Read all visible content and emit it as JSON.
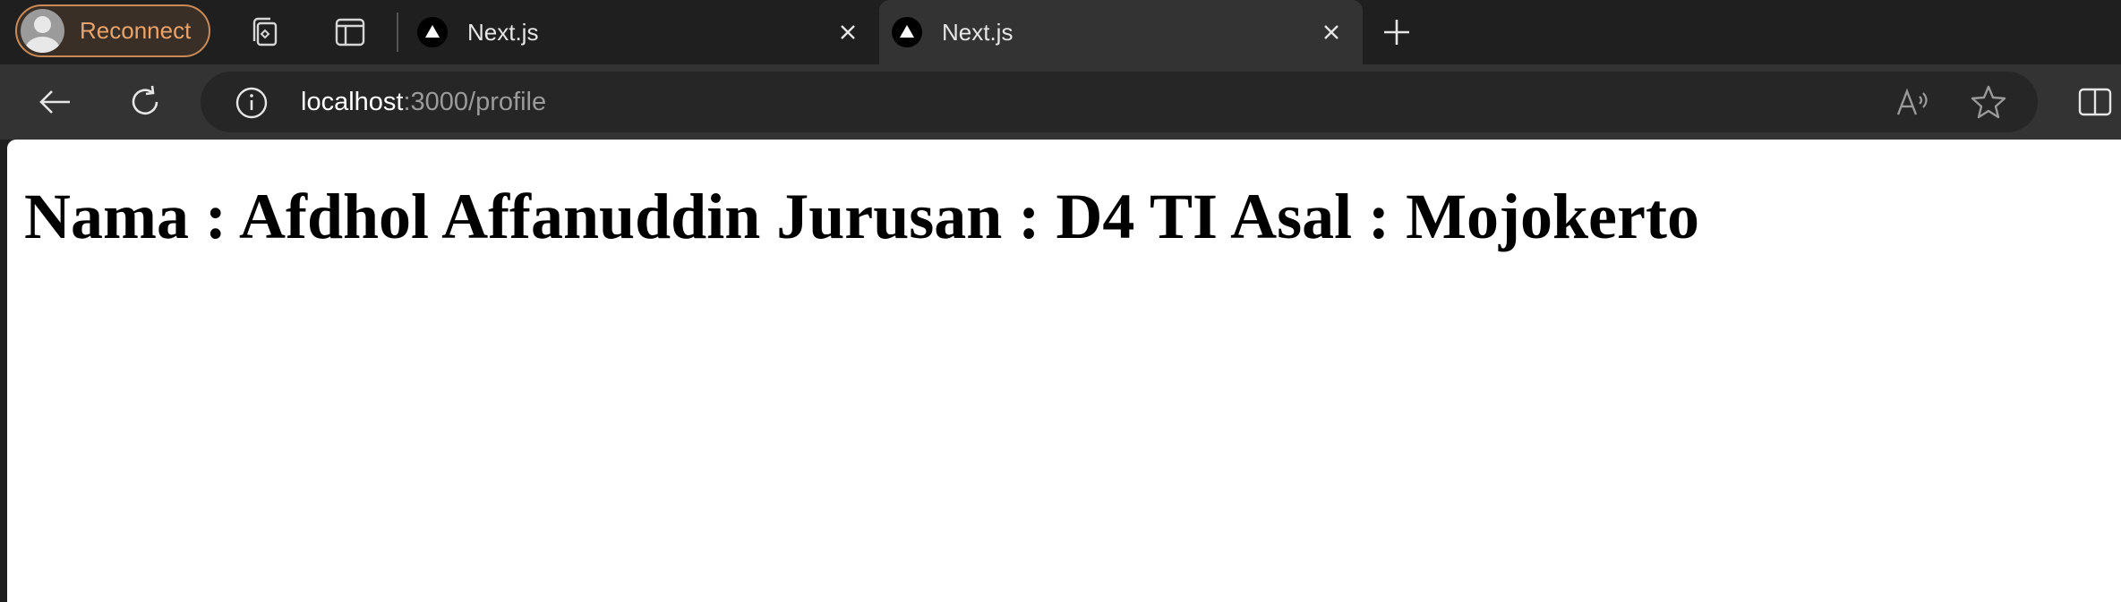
{
  "profile": {
    "label": "Reconnect"
  },
  "tabs": [
    {
      "title": "Next.js",
      "active": false
    },
    {
      "title": "Next.js",
      "active": true
    }
  ],
  "address_bar": {
    "host": "localhost",
    "rest": ":3000/profile"
  },
  "page": {
    "heading": "Nama : Afdhol Affanuddin Jurusan : D4 TI Asal : Mojokerto"
  },
  "icons": {
    "profile": "avatar-icon",
    "workspaces": "workspaces-icon",
    "tab_actions": "tab-actions-icon",
    "favicon": "nextjs-favicon-icon",
    "close": "close-icon",
    "new_tab": "plus-icon",
    "back": "back-arrow-icon",
    "refresh": "refresh-icon",
    "site_info": "info-icon",
    "read_aloud": "read-aloud-icon",
    "favorites": "star-icon",
    "split_screen": "split-screen-icon"
  },
  "colors": {
    "frame": "#1f1f1f",
    "toolbar": "#333333",
    "profile_accent": "#e9a46b",
    "page_background": "#ffffff"
  }
}
